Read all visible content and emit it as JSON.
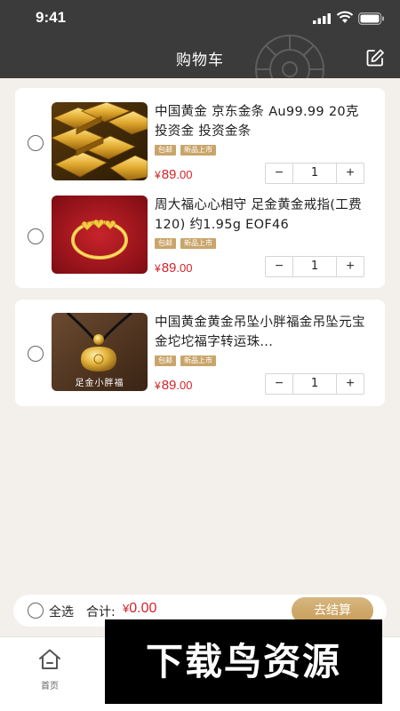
{
  "status_bar": {
    "time": "9:41"
  },
  "header": {
    "title": "购物车"
  },
  "cart": {
    "groups": [
      {
        "items": [
          {
            "name": "中国黄金 京东金条 Au99.99 20克 投资金 投资金条",
            "tags": [
              "包邮",
              "新品上市"
            ],
            "price_currency": "¥",
            "price_int": "89",
            "price_dec": ".00",
            "quantity": "1",
            "thumb_caption": ""
          },
          {
            "name": "周大福心心相守 足金黄金戒指(工费120) 约1.95g EOF46",
            "tags": [
              "包邮",
              "新品上市"
            ],
            "price_currency": "¥",
            "price_int": "89",
            "price_dec": ".00",
            "quantity": "1",
            "thumb_caption": ""
          }
        ]
      },
      {
        "items": [
          {
            "name": "中国黄金黄金吊坠小胖福金吊坠元宝金坨坨福字转运珠...",
            "tags": [
              "包邮",
              "新品上市"
            ],
            "price_currency": "¥",
            "price_int": "89",
            "price_dec": ".00",
            "quantity": "1",
            "thumb_caption": "足金小胖福"
          }
        ]
      }
    ],
    "stepper": {
      "minus": "−",
      "plus": "+"
    }
  },
  "summary": {
    "select_all": "全选",
    "total_label": "合计:",
    "total_currency": "¥",
    "total_value": "0.00",
    "checkout": "去结算"
  },
  "tabbar": {
    "home_label": "首页"
  },
  "watermark": {
    "text": "下载鸟资源"
  },
  "colors": {
    "header_bg": "#3b3b3b",
    "price": "#d3232a",
    "accent_gold": "#c9a56a",
    "page_bg": "#f3efea"
  }
}
